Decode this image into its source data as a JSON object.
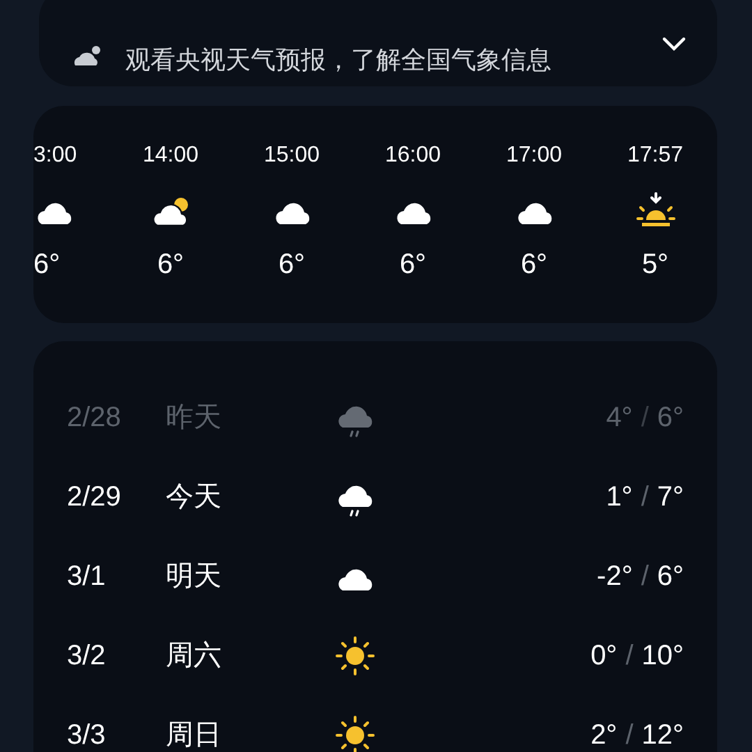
{
  "banner": {
    "text": "观看央视天气预报，了解全国气象信息"
  },
  "hourly": [
    {
      "time": "3:00",
      "kind": "cloud",
      "temp": "6°"
    },
    {
      "time": "14:00",
      "kind": "partly-cloudy",
      "temp": "6°"
    },
    {
      "time": "15:00",
      "kind": "cloud",
      "temp": "6°"
    },
    {
      "time": "16:00",
      "kind": "cloud",
      "temp": "6°"
    },
    {
      "time": "17:00",
      "kind": "cloud",
      "temp": "6°"
    },
    {
      "time": "17:57",
      "kind": "sunset",
      "temp": "5°"
    }
  ],
  "daily": [
    {
      "date": "2/28",
      "day": "昨天",
      "kind": "rain",
      "low": "4°",
      "sep": "/",
      "high": "6°",
      "past": true
    },
    {
      "date": "2/29",
      "day": "今天",
      "kind": "rain",
      "low": "1°",
      "sep": "/",
      "high": "7°",
      "past": false
    },
    {
      "date": "3/1",
      "day": "明天",
      "kind": "cloud",
      "low": "-2°",
      "sep": "/",
      "high": "6°",
      "past": false
    },
    {
      "date": "3/2",
      "day": "周六",
      "kind": "sun",
      "low": "0°",
      "sep": "/",
      "high": "10°",
      "past": false
    },
    {
      "date": "3/3",
      "day": "周日",
      "kind": "sun",
      "low": "2°",
      "sep": "/",
      "high": "12°",
      "past": false
    }
  ]
}
